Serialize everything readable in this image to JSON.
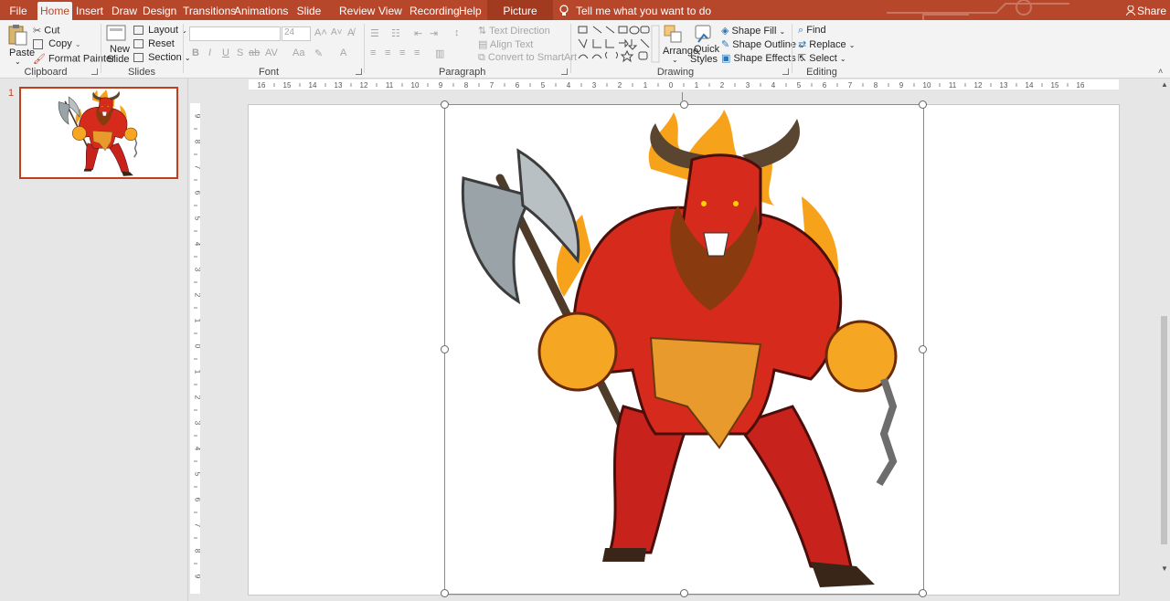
{
  "tabs": [
    {
      "id": "file",
      "label": "File"
    },
    {
      "id": "home",
      "label": "Home"
    },
    {
      "id": "insert",
      "label": "Insert"
    },
    {
      "id": "draw",
      "label": "Draw"
    },
    {
      "id": "design",
      "label": "Design"
    },
    {
      "id": "transitions",
      "label": "Transitions"
    },
    {
      "id": "animations",
      "label": "Animations"
    },
    {
      "id": "slideshow",
      "label": "Slide Show"
    },
    {
      "id": "review",
      "label": "Review"
    },
    {
      "id": "view",
      "label": "View"
    },
    {
      "id": "recording",
      "label": "Recording"
    },
    {
      "id": "help",
      "label": "Help"
    },
    {
      "id": "pictureformat",
      "label": "Picture Format"
    }
  ],
  "tell_me": "Tell me what you want to do",
  "share": "Share",
  "colors": {
    "accent": "#b7472a",
    "selection": "#c43e1c",
    "ribbon": "#f3f3f3"
  },
  "clipboard": {
    "paste": "Paste",
    "cut": "Cut",
    "copy": "Copy",
    "format_painter": "Format Painter",
    "label": "Clipboard"
  },
  "slides": {
    "new_slide_1": "New",
    "new_slide_2": "Slide",
    "layout": "Layout",
    "reset": "Reset",
    "section": "Section",
    "label": "Slides"
  },
  "font": {
    "size": "24",
    "bold": "B",
    "italic": "I",
    "underline": "U",
    "strike": "S",
    "label": "Font"
  },
  "paragraph": {
    "text_direction": "Text Direction",
    "align_text": "Align Text",
    "convert_smartart": "Convert to SmartArt",
    "label": "Paragraph"
  },
  "drawing": {
    "arrange": "Arrange",
    "quick_styles_1": "Quick",
    "quick_styles_2": "Styles",
    "shape_fill": "Shape Fill",
    "shape_outline": "Shape Outline",
    "shape_effects": "Shape Effects",
    "label": "Drawing"
  },
  "editing": {
    "find": "Find",
    "replace": "Replace",
    "select": "Select",
    "label": "Editing"
  },
  "slide_panel": {
    "number": "1"
  },
  "ruler": {
    "h_ticks": [
      "16",
      "15",
      "14",
      "13",
      "12",
      "11",
      "10",
      "9",
      "8",
      "7",
      "6",
      "5",
      "4",
      "3",
      "2",
      "1",
      "0",
      "1",
      "2",
      "3",
      "4",
      "5",
      "6",
      "7",
      "8",
      "9",
      "10",
      "11",
      "12",
      "13",
      "14",
      "15",
      "16"
    ],
    "v_ticks": [
      "9",
      "8",
      "7",
      "6",
      "5",
      "4",
      "3",
      "2",
      "1",
      "0",
      "1",
      "2",
      "3",
      "4",
      "5",
      "6",
      "7",
      "8",
      "9"
    ]
  },
  "picture": {
    "subject": "minotaur-demon-illustration"
  }
}
